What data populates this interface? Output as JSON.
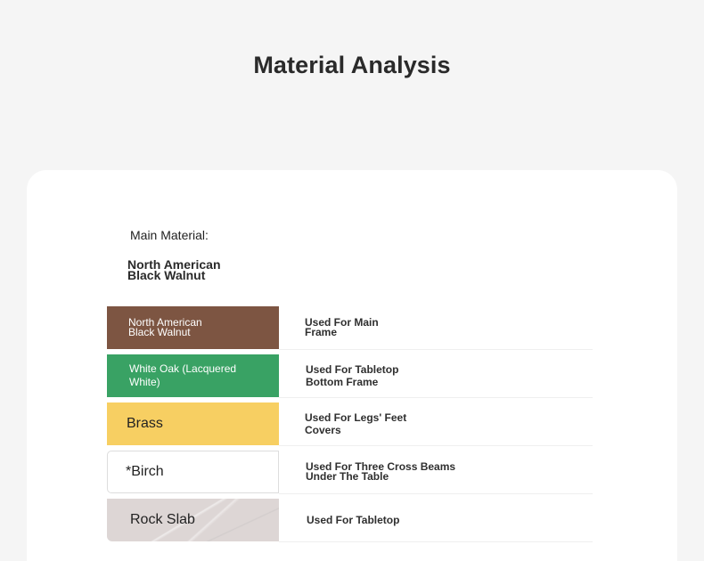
{
  "page": {
    "title": "Material Analysis"
  },
  "main_material": {
    "label": "Main Material:",
    "value_line_1": "North American",
    "value_line_2": "Black Walnut"
  },
  "materials": [
    {
      "name_line_1": "North American",
      "name_line_2": "Black Walnut",
      "use_line_1": "Used For Main",
      "use_line_2": "Frame",
      "swatch_color": "#7d5542"
    },
    {
      "name_line_1": "White Oak (Lacquered",
      "name_line_2": "White)",
      "use_line_1": "Used For Tabletop",
      "use_line_2": "Bottom Frame",
      "swatch_color": "#39a264"
    },
    {
      "name": "Brass",
      "use_line_1": "Used For Legs' Feet",
      "use_line_2": "Covers",
      "swatch_color": "#f7cf62"
    },
    {
      "name": "*Birch",
      "use_line_1": "Used For Three Cross Beams",
      "use_line_2": "Under The Table",
      "swatch_color": "#ffffff"
    },
    {
      "name": "Rock Slab",
      "use": "Used For Tabletop",
      "swatch_color": "#ddd6d5"
    }
  ]
}
